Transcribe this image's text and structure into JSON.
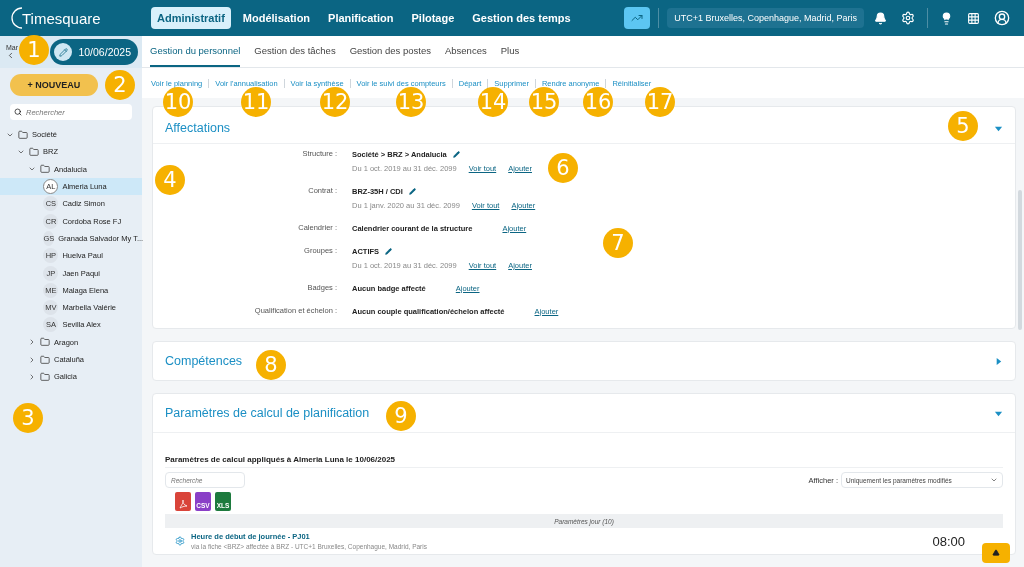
{
  "app": {
    "logo": "Timesquare",
    "nav": [
      {
        "label": "Administratif",
        "selected": true
      },
      {
        "label": "Modélisation",
        "selected": false
      },
      {
        "label": "Planification",
        "selected": false
      },
      {
        "label": "Pilotage",
        "selected": false
      },
      {
        "label": "Gestion des temps",
        "selected": false
      }
    ],
    "timezone": "UTC+1 Bruxelles, Copenhague, Madrid, Paris"
  },
  "sidebar": {
    "day": "Mar",
    "date": "10/06/2025",
    "new_button": "+ NOUVEAU",
    "search": {
      "placeholder": "Rechercher"
    },
    "tree": [
      {
        "kind": "folder",
        "label": "Société",
        "expanded": true,
        "children": [
          {
            "kind": "folder",
            "label": "BRZ",
            "expanded": true,
            "children": [
              {
                "kind": "folder",
                "label": "Andalucia",
                "expanded": true,
                "children": [
                  {
                    "kind": "person",
                    "initials": "AL",
                    "label": "Almeria Luna",
                    "selected": true
                  },
                  {
                    "kind": "person",
                    "initials": "CS",
                    "label": "Cadiz Simon",
                    "selected": false
                  },
                  {
                    "kind": "person",
                    "initials": "CR",
                    "label": "Cordoba Rose FJ",
                    "selected": false
                  },
                  {
                    "kind": "person",
                    "initials": "GS",
                    "label": "Granada Salvador My T...",
                    "selected": false
                  },
                  {
                    "kind": "person",
                    "initials": "HP",
                    "label": "Huelva Paul",
                    "selected": false
                  },
                  {
                    "kind": "person",
                    "initials": "JP",
                    "label": "Jaen Paqui",
                    "selected": false
                  },
                  {
                    "kind": "person",
                    "initials": "ME",
                    "label": "Malaga Elena",
                    "selected": false
                  },
                  {
                    "kind": "person",
                    "initials": "MV",
                    "label": "Marbella Valérie",
                    "selected": false
                  },
                  {
                    "kind": "person",
                    "initials": "SA",
                    "label": "Sevilla Alex",
                    "selected": false
                  }
                ]
              },
              {
                "kind": "folder",
                "label": "Aragon",
                "expanded": false
              },
              {
                "kind": "folder",
                "label": "Cataluña",
                "expanded": false
              },
              {
                "kind": "folder",
                "label": "Galicia",
                "expanded": false
              }
            ]
          }
        ]
      }
    ]
  },
  "tabs": [
    {
      "label": "Gestion du personnel",
      "selected": true
    },
    {
      "label": "Gestion des tâches",
      "selected": false
    },
    {
      "label": "Gestion des postes",
      "selected": false
    },
    {
      "label": "Absences",
      "selected": false
    },
    {
      "label": "Plus",
      "selected": false
    }
  ],
  "actions": [
    "Voir le planning",
    "Voir l'annualisation",
    "Voir la synthèse",
    "Voir le suivi des compteurs",
    "Départ",
    "Supprimer",
    "Rendre anonyme",
    "Réinitialiser"
  ],
  "affectations": {
    "title": "Affectations",
    "expanded": true,
    "rows": [
      {
        "label": "Structure :",
        "value": "Société > BRZ > Andalucia",
        "editable": true,
        "period": "Du 1 oct. 2019 au 31 déc. 2099",
        "links": [
          "Voir tout",
          "Ajouter"
        ]
      },
      {
        "label": "Contrat :",
        "value": "BRZ-35H / CDI",
        "editable": true,
        "period": "Du 1 janv. 2020 au 31 déc. 2099",
        "links": [
          "Voir tout",
          "Ajouter"
        ]
      },
      {
        "label": "Calendrier :",
        "value": "Calendrier courant de la structure",
        "editable": false,
        "links": [
          "Ajouter"
        ]
      },
      {
        "label": "Groupes :",
        "value": "ACTIFS",
        "editable": true,
        "period": "Du 1 oct. 2019 au 31 déc. 2099",
        "links": [
          "Voir tout",
          "Ajouter"
        ]
      },
      {
        "label": "Badges :",
        "value": "Aucun badge affecté",
        "editable": false,
        "links": [
          "Ajouter"
        ]
      },
      {
        "label": "Qualification et échelon :",
        "value": "Aucun couple qualification/échelon affecté",
        "editable": false,
        "links": [
          "Ajouter"
        ]
      }
    ]
  },
  "competences": {
    "title": "Compétences",
    "expanded": false
  },
  "parametres": {
    "title": "Paramètres de calcul de planification",
    "expanded": true,
    "heading": "Paramètres de calcul appliqués à Almeria Luna le 10/06/2025",
    "search": {
      "placeholder": "Recherche"
    },
    "filter_label": "Afficher :",
    "filter_value": "Uniquement les paramètres modifiés",
    "exports": [
      {
        "kind": "pdf"
      },
      {
        "kind": "csv",
        "label": "CSV"
      },
      {
        "kind": "xls",
        "label": "XLS"
      }
    ],
    "group": "Paramètres jour (10)",
    "rows": [
      {
        "title": "Heure de début de journée - PJ01",
        "subtitle": "via la fiche <BRZ> affectée à BRZ - UTC+1 Bruxelles, Copenhague, Madrid, Paris",
        "value": "08:00"
      }
    ]
  },
  "callouts": [
    "1",
    "2",
    "3",
    "4",
    "5",
    "6",
    "7",
    "8",
    "9",
    "10",
    "11",
    "12",
    "13",
    "14",
    "15",
    "16",
    "17"
  ]
}
